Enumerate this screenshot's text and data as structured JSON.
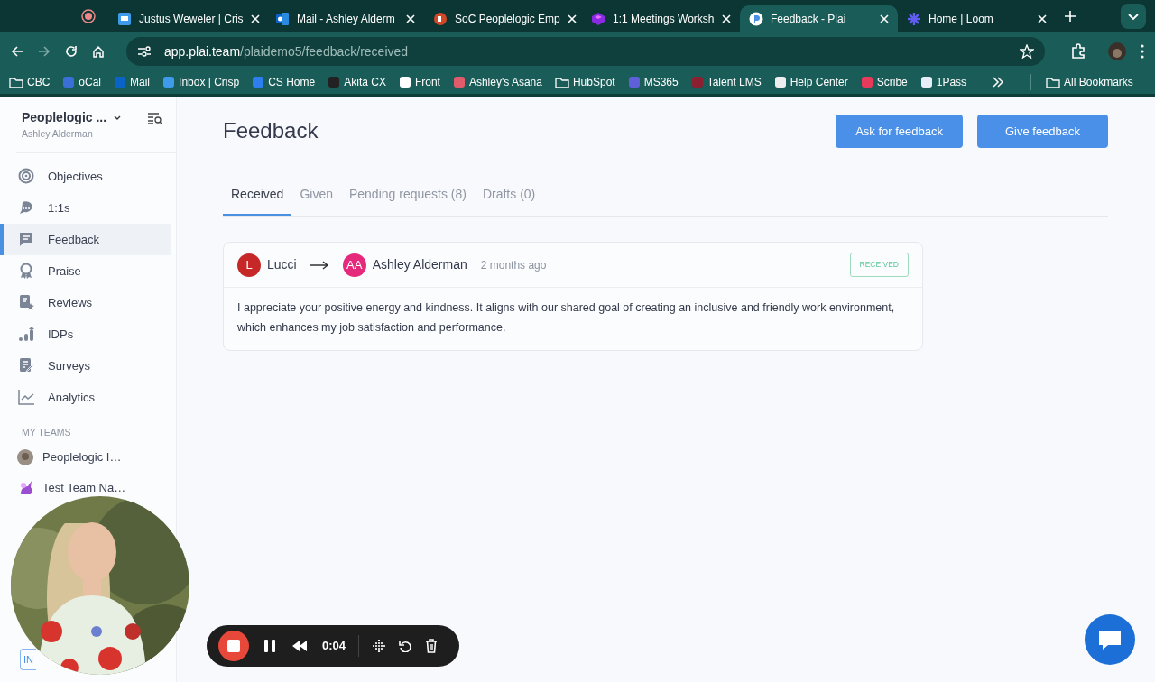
{
  "browser": {
    "tabs": [
      {
        "title": "Justus Weweler | Cris",
        "selected": false
      },
      {
        "title": "Mail - Ashley Alderm",
        "selected": false
      },
      {
        "title": "SoC Peoplelogic Emp",
        "selected": false
      },
      {
        "title": "1:1 Meetings Worksh",
        "selected": false
      },
      {
        "title": "Feedback - Plai",
        "selected": true
      },
      {
        "title": "Home | Loom",
        "selected": false
      }
    ],
    "address": {
      "host": "app.plai.team",
      "path": "/plaidemo5/feedback/received"
    },
    "bookmarks": [
      {
        "label": "CBC",
        "kind": "folder"
      },
      {
        "label": "oCal",
        "kind": "site"
      },
      {
        "label": "Mail",
        "kind": "site"
      },
      {
        "label": "Inbox | Crisp",
        "kind": "site"
      },
      {
        "label": "CS Home",
        "kind": "site"
      },
      {
        "label": "Akita CX",
        "kind": "site"
      },
      {
        "label": "Front",
        "kind": "site"
      },
      {
        "label": "Ashley's Asana",
        "kind": "site"
      },
      {
        "label": "HubSpot",
        "kind": "folder"
      },
      {
        "label": "MS365",
        "kind": "site"
      },
      {
        "label": "Talent LMS",
        "kind": "site"
      },
      {
        "label": "Help Center",
        "kind": "site"
      },
      {
        "label": "Scribe",
        "kind": "site"
      },
      {
        "label": "1Pass",
        "kind": "site"
      }
    ],
    "all_bookmarks": "All Bookmarks"
  },
  "sidebar": {
    "org": "Peoplelogic ...",
    "user": "Ashley Alderman",
    "nav": [
      {
        "label": "Objectives",
        "selected": false
      },
      {
        "label": "1:1s",
        "selected": false
      },
      {
        "label": "Feedback",
        "selected": true
      },
      {
        "label": "Praise",
        "selected": false
      },
      {
        "label": "Reviews",
        "selected": false
      },
      {
        "label": "IDPs",
        "selected": false
      },
      {
        "label": "Surveys",
        "selected": false
      },
      {
        "label": "Analytics",
        "selected": false
      }
    ],
    "teams_heading": "MY TEAMS",
    "teams": [
      {
        "name": "Peoplelogic I…"
      },
      {
        "name": "Test Team Na…"
      }
    ],
    "partial_button": "IN"
  },
  "page": {
    "title": "Feedback",
    "actions": [
      "Ask for feedback",
      "Give feedback"
    ],
    "tabs": [
      {
        "label": "Received",
        "selected": true
      },
      {
        "label": "Given",
        "selected": false
      },
      {
        "label": "Pending requests (8)",
        "selected": false
      },
      {
        "label": "Drafts (0)",
        "selected": false
      }
    ],
    "feedback": [
      {
        "from": {
          "initials": "L",
          "name": "Lucci",
          "color": "#c62828"
        },
        "to": {
          "initials": "AA",
          "name": "Ashley Alderman",
          "color": "#e52a7c"
        },
        "time": "2 months ago",
        "status": "RECEIVED",
        "message": "I appreciate your positive energy and kindness. It aligns with our shared goal of creating an inclusive and friendly work environment, which enhances my job satisfaction and performance."
      }
    ]
  },
  "recorder": {
    "time": "0:04"
  }
}
